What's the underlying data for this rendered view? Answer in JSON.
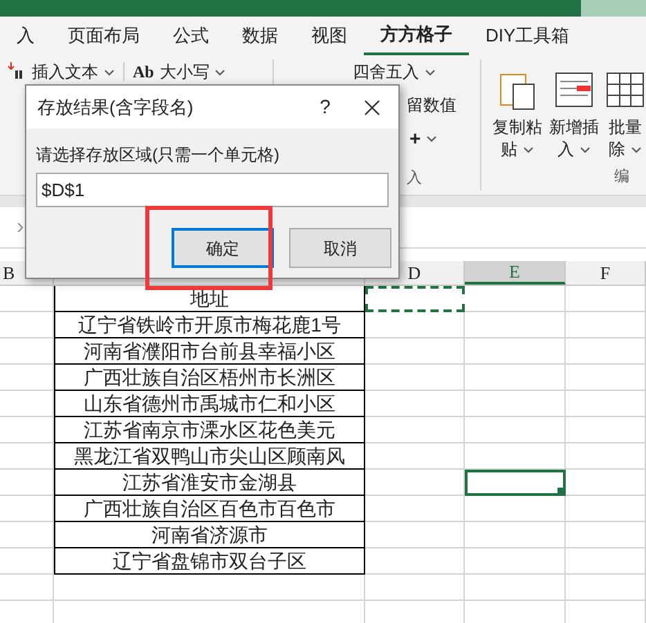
{
  "tabs": [
    {
      "label": "入",
      "selected": false
    },
    {
      "label": "页面布局",
      "selected": false
    },
    {
      "label": "公式",
      "selected": false
    },
    {
      "label": "数据",
      "selected": false
    },
    {
      "label": "视图",
      "selected": false
    },
    {
      "label": "方方格子",
      "selected": true
    },
    {
      "label": "DIY工具箱",
      "selected": false
    }
  ],
  "ribbon": {
    "insert_text": "插入文本",
    "case_prefix": "Ab",
    "case": "大小写",
    "round": "四舍五入",
    "keep_values": "留数值",
    "plus": "+",
    "group_label": "入",
    "copy_paste": [
      "复制粘",
      "贴"
    ],
    "new_insert": [
      "新增插",
      "入"
    ],
    "batch_delete": [
      "批量",
      "除"
    ],
    "edit_group": "编"
  },
  "formula_bar": {
    "expand": "›"
  },
  "dialog": {
    "title": "存放结果(含字段名)",
    "help": "?",
    "prompt": "请选择存放区域(只需一个单元格)",
    "value": "$D$1",
    "buttons": [
      {
        "label": "确定",
        "focused": true
      },
      {
        "label": "取消",
        "focused": false
      }
    ],
    "highlighted": true
  },
  "sheet": {
    "columns": [
      {
        "label": "B",
        "selected": false
      },
      {
        "label": "D",
        "selected": false
      },
      {
        "label": "E",
        "selected": true
      },
      {
        "label": "F",
        "selected": false
      }
    ],
    "rows": [
      {
        "c": "地址",
        "marquee": true,
        "selected": false
      },
      {
        "c": "辽宁省铁岭市开原市梅花鹿1号",
        "marquee": false,
        "selected": false
      },
      {
        "c": "河南省濮阳市台前县幸福小区",
        "marquee": false,
        "selected": false
      },
      {
        "c": "广西壮族自治区梧州市长洲区",
        "marquee": false,
        "selected": false
      },
      {
        "c": "山东省德州市禹城市仁和小区",
        "marquee": false,
        "selected": false
      },
      {
        "c": "江苏省南京市溧水区花色美元",
        "marquee": false,
        "selected": false
      },
      {
        "c": "黑龙江省双鸭山市尖山区顾南风",
        "marquee": false,
        "selected": false
      },
      {
        "c": "江苏省淮安市金湖县",
        "marquee": false,
        "selected": true
      },
      {
        "c": "广西壮族自治区百色市百色市",
        "marquee": false,
        "selected": false
      },
      {
        "c": "河南省济源市",
        "marquee": false,
        "selected": false
      },
      {
        "c": "辽宁省盘锦市双台子区",
        "marquee": false,
        "selected": false
      }
    ]
  }
}
